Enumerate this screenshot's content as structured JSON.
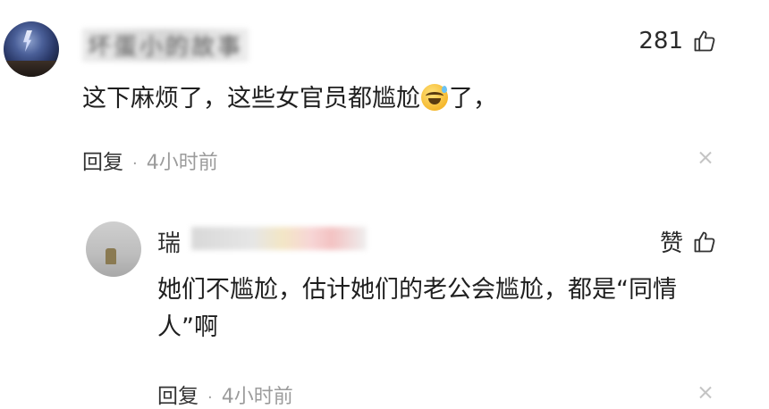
{
  "comment": {
    "username": "坏蛋小的故事",
    "text_before_emoji": "这下麻烦了，这些女官员都尴尬",
    "emoji": "sweat-smile-emoji",
    "text_after_emoji": "了，",
    "reply_label": "回复",
    "separator": "·",
    "time": "4小时前",
    "like_count": "281",
    "like_icon": "thumbs-up-icon"
  },
  "reply": {
    "username_visible": "瑞",
    "text": "她们不尴尬，估计她们的老公会尴尬，都是“同情人”啊",
    "reply_label": "回复",
    "separator": "·",
    "time": "4小时前",
    "like_label": "赞",
    "like_icon": "thumbs-up-icon"
  },
  "colors": {
    "background": "#ffffff",
    "text": "#1f1f1f",
    "muted": "#9b9b9b"
  }
}
